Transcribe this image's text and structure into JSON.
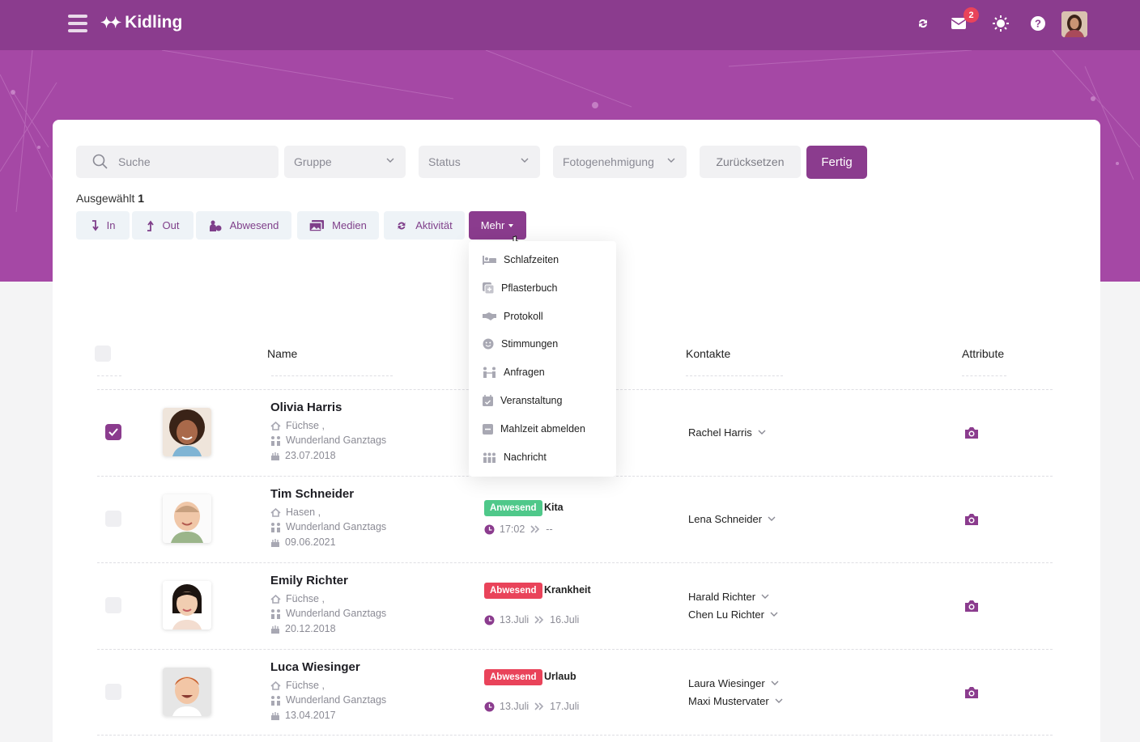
{
  "header": {
    "app_name": "Kidling",
    "unread_badge": "2",
    "icons": [
      "menu-icon",
      "refresh-icon",
      "mail-icon",
      "sun-icon",
      "help-icon",
      "user-avatar"
    ]
  },
  "filters": {
    "search_placeholder": "Suche",
    "group": "Gruppe",
    "status": "Status",
    "photo_permission": "Fotogenehmigung",
    "reset": "Zurücksetzen",
    "done": "Fertig"
  },
  "selection": {
    "label": "Ausgewählt",
    "count": "1"
  },
  "actions": {
    "in": "In",
    "out": "Out",
    "absent": "Abwesend",
    "media": "Medien",
    "activity": "Aktivität",
    "more": "Mehr"
  },
  "more_menu": [
    {
      "label": "Schlafzeiten",
      "icon": "bed-icon"
    },
    {
      "label": "Pflasterbuch",
      "icon": "bandage-book-icon"
    },
    {
      "label": "Protokoll",
      "icon": "handshake-icon"
    },
    {
      "label": "Stimmungen",
      "icon": "smiley-icon"
    },
    {
      "label": "Anfragen",
      "icon": "people-icon"
    },
    {
      "label": "Veranstaltung",
      "icon": "calendar-check-icon"
    },
    {
      "label": "Mahlzeit abmelden",
      "icon": "minus-square-icon"
    },
    {
      "label": "Nachricht",
      "icon": "group-icon"
    }
  ],
  "table": {
    "columns": {
      "name": "Name",
      "contacts": "Kontakte",
      "attributes": "Attribute"
    },
    "rows": [
      {
        "name": "Olivia Harris",
        "group": "Füchse ,",
        "facility": "Wunderland Ganztags",
        "birthday": "23.07.2018",
        "checked": true,
        "contacts": [
          "Rachel Harris"
        ]
      },
      {
        "name": "Tim Schneider",
        "group": "Hasen ,",
        "facility": "Wunderland Ganztags",
        "birthday": "09.06.2021",
        "checked": false,
        "status": "Anwesend",
        "reason": "Kita",
        "time_from": "17:02",
        "time_to": "--",
        "contacts": [
          "Lena Schneider"
        ]
      },
      {
        "name": "Emily Richter",
        "group": "Füchse ,",
        "facility": "Wunderland Ganztags",
        "birthday": "20.12.2018",
        "checked": false,
        "status": "Abwesend",
        "reason": "Krankheit",
        "time_from": "13.Juli",
        "time_to": "16.Juli",
        "contacts": [
          "Harald Richter",
          "Chen Lu Richter"
        ]
      },
      {
        "name": "Luca Wiesinger",
        "group": "Füchse ,",
        "facility": "Wunderland Ganztags",
        "birthday": "13.04.2017",
        "checked": false,
        "status": "Abwesend",
        "reason": "Urlaub",
        "time_from": "13.Juli",
        "time_to": "17.Juli",
        "contacts": [
          "Laura Wiesinger",
          "Maxi Mustervater"
        ]
      }
    ]
  },
  "colors": {
    "brand": "#8b3c8e",
    "present": "#4fc88a",
    "absent": "#e9435a"
  }
}
